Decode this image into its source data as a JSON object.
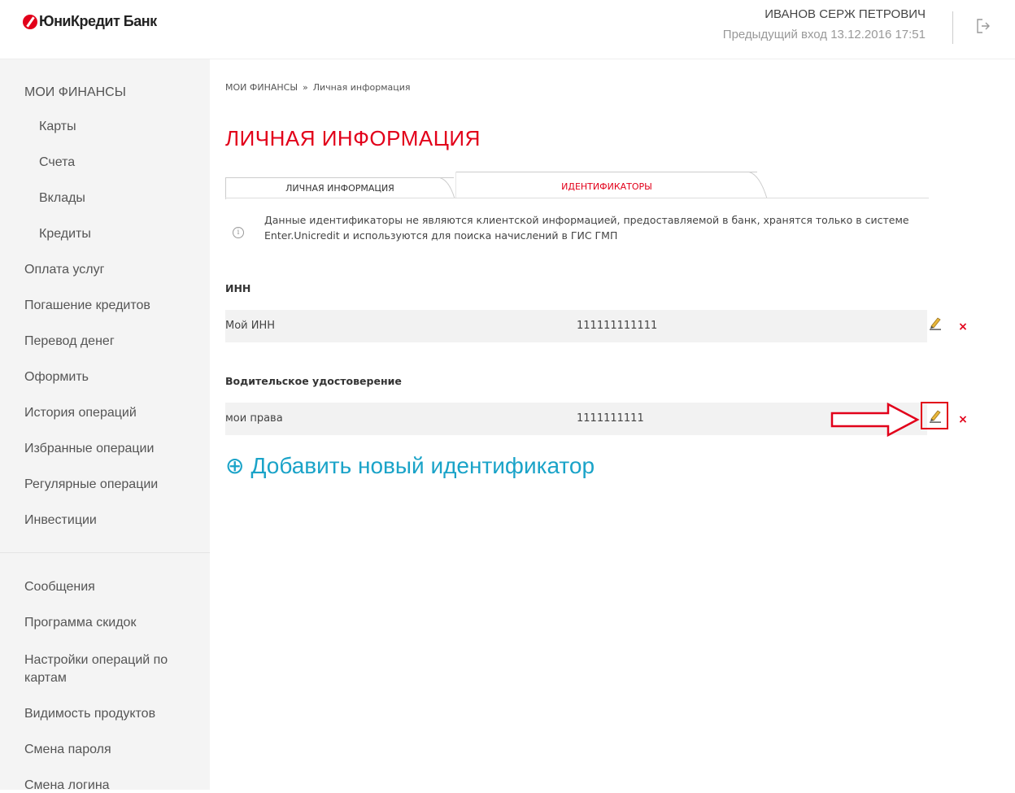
{
  "header": {
    "logo": "ЮниКредит Банк",
    "user_name": "ИВАНОВ СЕРЖ ПЕТРОВИЧ",
    "last_login": "Предыдущий вход 13.12.2016 17:51"
  },
  "sidebar": {
    "items": [
      {
        "label": "МОИ ФИНАНСЫ"
      },
      {
        "label": "Карты"
      },
      {
        "label": "Счета"
      },
      {
        "label": "Вклады"
      },
      {
        "label": "Кредиты"
      },
      {
        "label": "Оплата услуг"
      },
      {
        "label": "Погашение кредитов"
      },
      {
        "label": "Перевод денег"
      },
      {
        "label": "Оформить"
      },
      {
        "label": "История операций"
      },
      {
        "label": "Избранные операции"
      },
      {
        "label": "Регулярные операции"
      },
      {
        "label": "Инвестиции"
      },
      {
        "label": "Сообщения"
      },
      {
        "label": "Программа скидок"
      },
      {
        "label": "Настройки операций по картам"
      },
      {
        "label": "Видимость продуктов"
      },
      {
        "label": "Смена пароля"
      },
      {
        "label": "Смена логина"
      }
    ]
  },
  "breadcrumb": {
    "root": "МОИ ФИНАНСЫ",
    "separator": "»",
    "current": "Личная информация"
  },
  "page_title": "ЛИЧНАЯ ИНФОРМАЦИЯ",
  "tabs": [
    {
      "label": "ЛИЧНАЯ ИНФОРМАЦИЯ",
      "active": false
    },
    {
      "label": "ИДЕНТИФИКАТОРЫ",
      "active": true
    }
  ],
  "info_text": "Данные идентификаторы не являются клиентской информацией, предоставляемой в банк, хранятся только в системе Enter.Unicredit и используются для поиска начислений в ГИС ГМП",
  "groups": [
    {
      "title": "ИНН",
      "rows": [
        {
          "name": "Мой ИНН",
          "value": "111111111111"
        }
      ]
    },
    {
      "title": "Водительское удостоверение",
      "rows": [
        {
          "name": "мои права",
          "value": "1111111111"
        }
      ]
    }
  ],
  "add_link": "Добавить новый идентификатор",
  "colors": {
    "accent": "#e2001a",
    "link": "#1aa3c8",
    "sidebar_bg": "#f4f4f4"
  },
  "icons": {
    "info": "info-icon",
    "edit": "pencil-icon",
    "delete": "close-icon",
    "logout": "logout-icon",
    "add": "plus-circle-icon"
  }
}
